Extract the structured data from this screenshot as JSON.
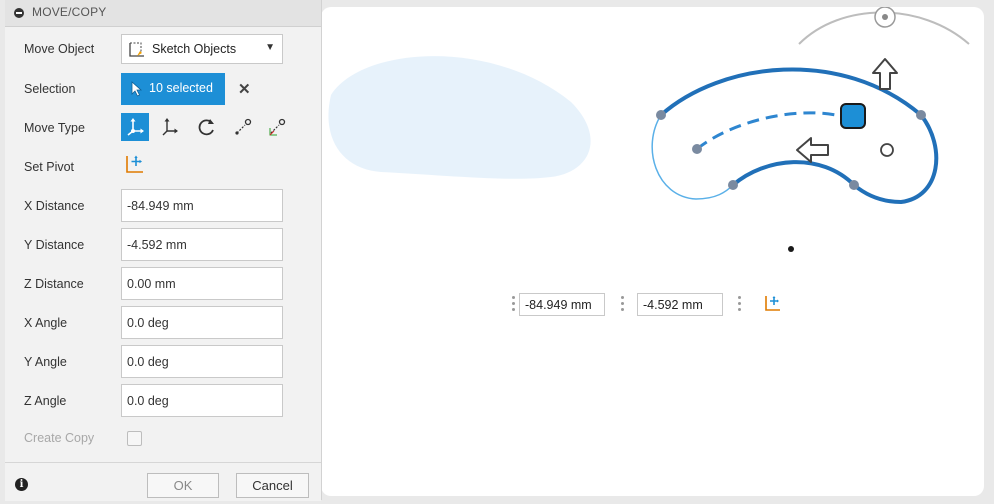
{
  "dialog": {
    "title": "MOVE/COPY",
    "move_object": {
      "label": "Move Object",
      "value": "Sketch Objects"
    },
    "selection": {
      "label": "Selection",
      "value": "10 selected"
    },
    "move_type": {
      "label": "Move Type",
      "options": [
        "free-move",
        "translate",
        "rotate",
        "point-to-point",
        "point-to-position"
      ],
      "active": "free-move"
    },
    "set_pivot": {
      "label": "Set Pivot"
    },
    "fields": [
      {
        "label": "X Distance",
        "value": "-84.949 mm"
      },
      {
        "label": "Y Distance",
        "value": "-4.592 mm"
      },
      {
        "label": "Z Distance",
        "value": "0.00 mm"
      },
      {
        "label": "X Angle",
        "value": "0.0 deg"
      },
      {
        "label": "Y Angle",
        "value": "0.0 deg"
      },
      {
        "label": "Z Angle",
        "value": "0.0 deg"
      }
    ],
    "create_copy": {
      "label": "Create Copy",
      "checked": false
    },
    "ok_label": "OK",
    "cancel_label": "Cancel"
  },
  "hud": {
    "x_value": "-84.949 mm",
    "y_value": "-4.592 mm"
  },
  "colors": {
    "accent": "#1d8fd6",
    "sketch_blue": "#2170b8",
    "panel_bg": "#f2f2f2"
  }
}
